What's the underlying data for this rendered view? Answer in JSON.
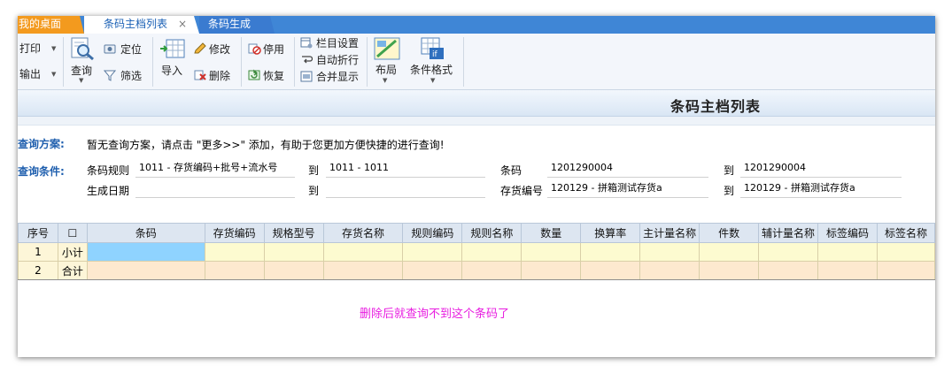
{
  "tabs": {
    "desktop": "我的桌面",
    "barcode_list": "条码主档列表",
    "close_glyph": "×",
    "barcode_gen": "条码生成"
  },
  "toolbar": {
    "print": "打印",
    "export": "输出",
    "query": "查询",
    "locate": "定位",
    "filter": "筛选",
    "import": "导入",
    "edit": "修改",
    "delete": "删除",
    "disable": "停用",
    "restore": "恢复",
    "column_settings": "栏目设置",
    "auto_wrap": "自动折行",
    "merge_display": "合并显示",
    "layout": "布局",
    "conditional_format": "条件格式"
  },
  "page": {
    "title": "条码主档列表"
  },
  "query": {
    "scheme_label": "查询方案:",
    "scheme_text": "暂无查询方案，请点击 \"更多>>\" 添加，有助于您更加方便快捷的进行查询!",
    "condition_label": "查询条件:",
    "to": "到",
    "fields": {
      "barcode_rule": {
        "label": "条码规则",
        "from": "1011 - 存货编码+批号+流水号",
        "to": "1011 - 1011"
      },
      "barcode": {
        "label": "条码",
        "from": "1201290004",
        "to": "1201290004"
      },
      "gen_date": {
        "label": "生成日期",
        "from": "",
        "to": ""
      },
      "item_code": {
        "label": "存货编号",
        "from": "120129 - 拼箱测试存货a",
        "to": "120129 - 拼箱测试存货a"
      }
    }
  },
  "grid": {
    "columns": [
      "序号",
      "☐",
      "条码",
      "存货编码",
      "规格型号",
      "存货名称",
      "规则编码",
      "规则名称",
      "数量",
      "换算率",
      "主计量名称",
      "件数",
      "辅计量名称",
      "标签编码",
      "标签名称"
    ],
    "rows": [
      {
        "no": "1",
        "label": "小计"
      },
      {
        "no": "2",
        "label": "合计"
      }
    ]
  },
  "annotation": "删除后就查询不到这个条码了",
  "colors": {
    "tab_active_text": "#1a60b5",
    "tab_bar": "#3f86d6",
    "desktop_tab": "#f39a1e",
    "note": "#e81ee0",
    "selected_cell": "#8fd3ff"
  }
}
